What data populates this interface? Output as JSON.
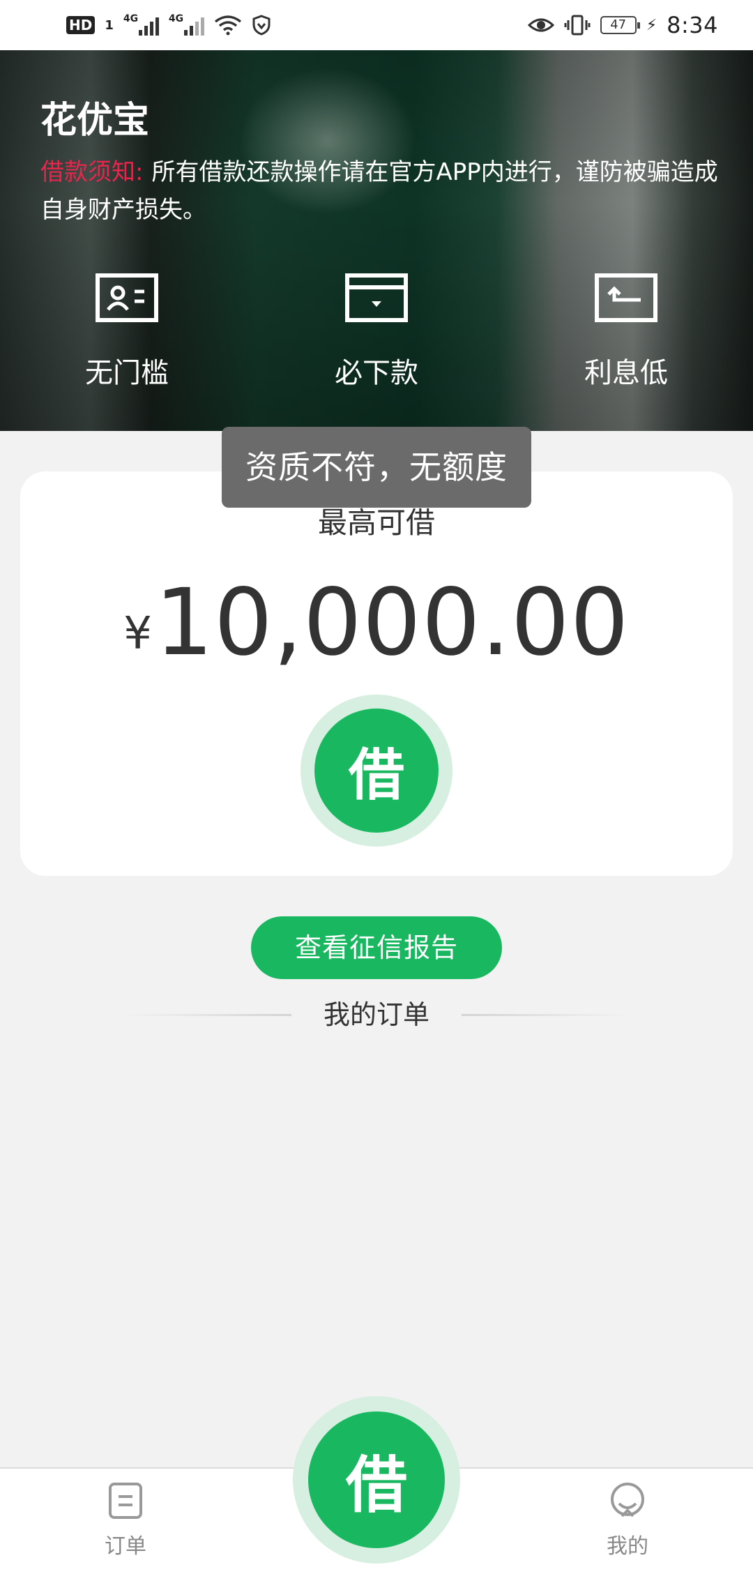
{
  "status_bar": {
    "hd_label": "HD",
    "sim_label": "1",
    "signal1_label": "4G",
    "signal2_label": "4G",
    "battery_level": "47",
    "time": "8:34"
  },
  "header": {
    "title": "花优宝",
    "notice_label": "借款须知:",
    "notice_text": "所有借款还款操作请在官方APP内进行，谨防被骗造成自身财产损失。",
    "features": [
      {
        "label": "无门槛",
        "icon": "id-card-icon"
      },
      {
        "label": "必下款",
        "icon": "wallet-icon"
      },
      {
        "label": "利息低",
        "icon": "return-card-icon"
      }
    ]
  },
  "toast": {
    "message": "资质不符，无额度"
  },
  "loan_card": {
    "label": "最高可借",
    "currency": "¥",
    "amount": "10,000.00",
    "borrow_label": "借"
  },
  "credit_report_button": "查看征信报告",
  "orders_section_title": "我的订单",
  "bottom_nav": {
    "orders_label": "订单",
    "center_label": "借",
    "mine_label": "我的"
  },
  "colors": {
    "accent_green": "#19b860",
    "notice_red": "#e8264c"
  }
}
